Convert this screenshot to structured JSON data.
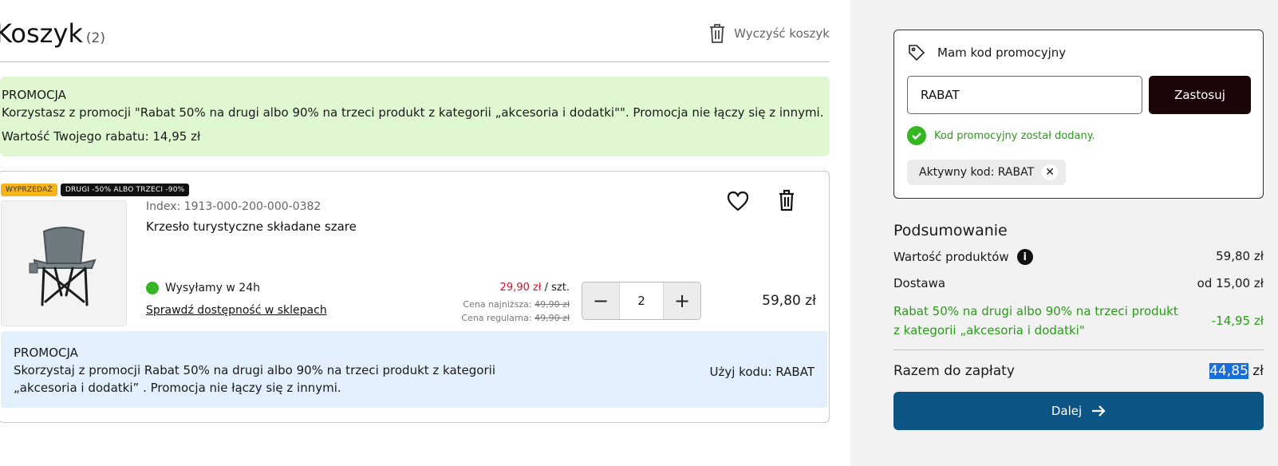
{
  "cart": {
    "title": "Koszyk",
    "count": "(2)",
    "clear_label": "Wyczyść koszyk"
  },
  "promo_green": {
    "title": "PROMOCJA",
    "text": "Korzystasz z promocji \"Rabat 50% na drugi albo 90% na trzeci produkt z kategorii „akcesoria i dodatki\"\". Promocja nie łączy się z innymi.",
    "discount_value": "Wartość Twojego rabatu: 14,95 zł"
  },
  "product": {
    "badges": [
      "WYPRZEDAŻ",
      "DRUGI -50% ALBO TRZECI -90%"
    ],
    "index": "Index: 1913-000-200-000-0382",
    "name": "Krzesło turystyczne składane szare",
    "shipping": "Wysyłamy w 24h",
    "stock_link": "Sprawdź dostępność w sklepach",
    "unit_price": "29,90 zł",
    "unit_suffix": " / szt.",
    "lowest_label": "Cena najniższa:",
    "lowest_price": "49,90 zł",
    "regular_label": "Cena regularna:",
    "regular_price": "49,90 zł",
    "quantity": "2",
    "total": "59,80 zł",
    "minus": "−",
    "plus": "+"
  },
  "promo_blue": {
    "title": "PROMOCJA",
    "text": "Skorzystaj z promocji Rabat 50% na drugi albo 90% na trzeci produkt z kategorii „akcesoria i dodatki” . Promocja nie łączy się z innymi.",
    "code": "Użyj kodu: RABAT"
  },
  "promo_code": {
    "header": "Mam kod promocyjny",
    "input_value": "RABAT",
    "apply": "Zastosuj",
    "success": "Kod promocyjny został dodany.",
    "active": "Aktywny kod: RABAT",
    "remove": "✕"
  },
  "summary": {
    "title": "Podsumowanie",
    "products_label": "Wartość produktów",
    "products_value": "59,80 zł",
    "delivery_label": "Dostawa",
    "delivery_value": "od 15,00 zł",
    "discount_label": "Rabat 50% na drugi albo 90% na trzeci produkt z kategorii „akcesoria i dodatki\"",
    "discount_value": "-14,95 zł",
    "total_label": "Razem do zapłaty",
    "total_amount": "44,85",
    "total_currency": " zł",
    "next": "Dalej"
  },
  "icons": {
    "info": "i"
  },
  "colors": {
    "success_green": "#35b622",
    "promo_green_bg": "#dff8d1",
    "promo_blue_bg": "#e1f0fc",
    "primary_button": "#0d5584",
    "apply_button": "#1b0508",
    "sale_badge": "#f6b41c",
    "price_red": "#d0112b"
  }
}
